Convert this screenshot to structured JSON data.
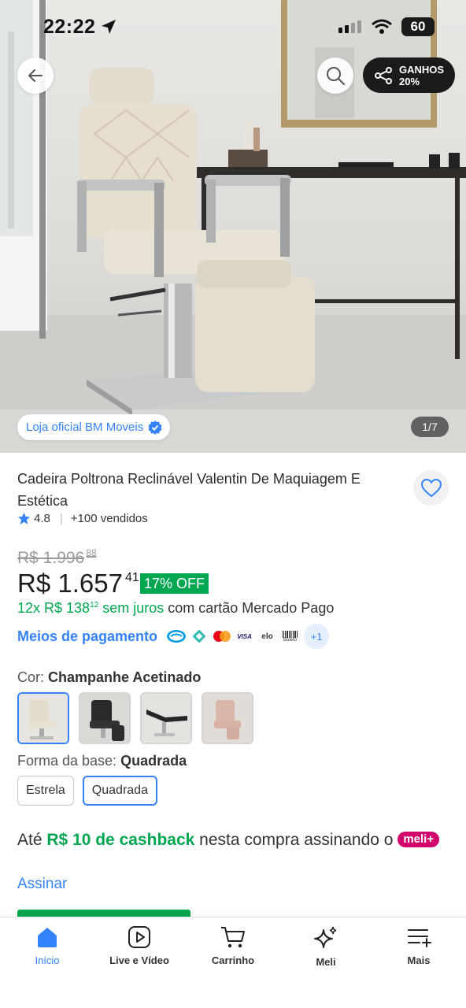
{
  "status_bar": {
    "time": "22:22",
    "battery": "60"
  },
  "header": {
    "share_label": "GANHOS",
    "share_value": "20%"
  },
  "gallery": {
    "store_label": "Loja oficial BM Moveis",
    "counter": "1/7",
    "current": 1,
    "total": 7
  },
  "product": {
    "title": "Cadeira Poltrona Reclinável Valentin De Maquiagem E Estética",
    "rating": "4.8",
    "sold": "+100 vendidos",
    "old_price": "R$ 1.996",
    "old_price_cents": "88",
    "price": "R$ 1.657",
    "price_cents": "41",
    "discount": "17% OFF",
    "installments_prefix": "12x R$ 138",
    "installments_cents": "12",
    "installments_suffix": " sem juros",
    "installments_card": " com cartão Mercado Pago",
    "payment_link": "Meios de pagamento",
    "payment_icons": [
      "mercado-pago-icon",
      "pix-icon",
      "mastercard-icon",
      "visa-icon",
      "elo-icon",
      "boleto-icon"
    ],
    "payment_labels": {
      "visa": "VISA",
      "elo": "elo",
      "boleto": "Boleto"
    },
    "payment_more": "+1"
  },
  "variations": {
    "color_label": "Cor:",
    "color_value": "Champanhe Acetinado",
    "base_label": "Forma da base:",
    "base_value": "Quadrada",
    "base_options": [
      "Estrela",
      "Quadrada"
    ]
  },
  "cashback": {
    "prefix": "Até ",
    "highlight": "R$ 10 de cashback",
    "middle": " nesta compra assinando o ",
    "badge": "meli+",
    "link": "Assinar"
  },
  "tabbar": {
    "items": [
      {
        "label": "Início",
        "icon": "home-icon",
        "active": true
      },
      {
        "label": "Live e Vídeo",
        "icon": "play-icon",
        "active": false
      },
      {
        "label": "Carrinho",
        "icon": "cart-icon",
        "active": false
      },
      {
        "label": "Meli",
        "icon": "sparkle-icon",
        "active": false
      },
      {
        "label": "Mais",
        "icon": "menu-plus-icon",
        "active": false
      }
    ]
  },
  "colors": {
    "accent": "#3483fa",
    "green": "#00a650",
    "meli_plus": "#d2006b"
  }
}
